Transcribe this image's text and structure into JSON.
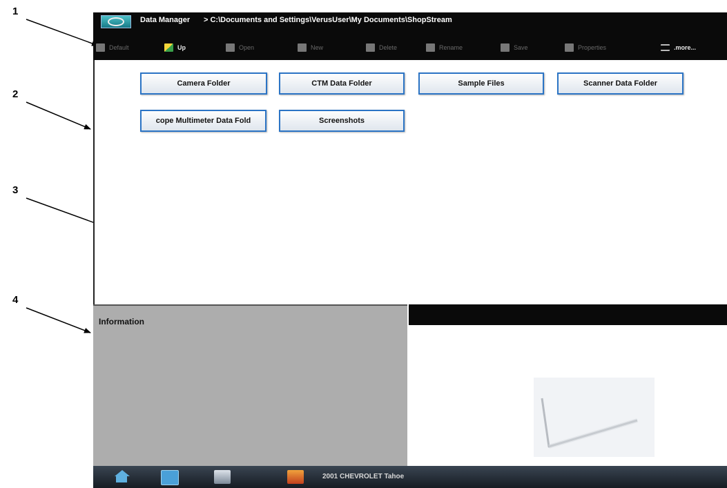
{
  "callouts": [
    "1",
    "2",
    "3",
    "4"
  ],
  "window": {
    "title": "Data Manager",
    "path": "> C:\\Documents and Settings\\VerusUser\\My Documents\\ShopStream"
  },
  "toolbar": {
    "default_label": "Default",
    "up_label": "Up",
    "open_label": "Open",
    "new_label": "New",
    "delete_label": "Delete",
    "rename_label": "Rename",
    "save_label": "Save",
    "properties_label": "Properties",
    "more_label": ".more..."
  },
  "folders": [
    "Camera Folder",
    "CTM Data Folder",
    "Sample Files",
    "Scanner Data Folder",
    "cope Multimeter Data Fold",
    "Screenshots"
  ],
  "info_panel": {
    "title": "Information"
  },
  "taskbar": {
    "vehicle": "2001 CHEVROLET Tahoe"
  },
  "icons": [
    "app-logo-icon",
    "home-icon",
    "screenshot-icon",
    "tools-icon",
    "vehicle-icon",
    "more-menu-icon"
  ]
}
